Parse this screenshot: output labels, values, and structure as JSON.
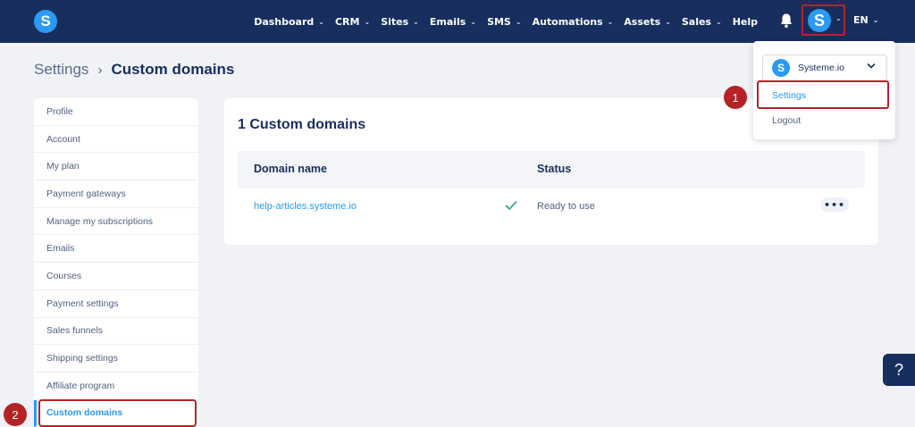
{
  "brand": {
    "logo_letter": "S"
  },
  "nav": {
    "items": [
      {
        "label": "Dashboard",
        "has_dropdown": true
      },
      {
        "label": "CRM",
        "has_dropdown": true
      },
      {
        "label": "Sites",
        "has_dropdown": true
      },
      {
        "label": "Emails",
        "has_dropdown": true
      },
      {
        "label": "SMS",
        "has_dropdown": true
      },
      {
        "label": "Automations",
        "has_dropdown": true
      },
      {
        "label": "Assets",
        "has_dropdown": true
      },
      {
        "label": "Sales",
        "has_dropdown": true
      },
      {
        "label": "Help",
        "has_dropdown": false
      }
    ],
    "bell_icon": "bell-icon",
    "avatar_letter": "S",
    "language": "EN"
  },
  "breadcrumb": {
    "parent": "Settings",
    "separator": "›",
    "current": "Custom domains"
  },
  "sidebar": {
    "items": [
      {
        "label": "Profile",
        "active": false
      },
      {
        "label": "Account",
        "active": false
      },
      {
        "label": "My plan",
        "active": false
      },
      {
        "label": "Payment gateways",
        "active": false
      },
      {
        "label": "Manage my subscriptions",
        "active": false
      },
      {
        "label": "Emails",
        "active": false
      },
      {
        "label": "Courses",
        "active": false
      },
      {
        "label": "Payment settings",
        "active": false
      },
      {
        "label": "Sales funnels",
        "active": false
      },
      {
        "label": "Shipping settings",
        "active": false
      },
      {
        "label": "Affiliate program",
        "active": false
      },
      {
        "label": "Custom domains",
        "active": true
      }
    ]
  },
  "main": {
    "title": "1 Custom domains",
    "table": {
      "headers": {
        "domain": "Domain name",
        "status": "Status"
      },
      "rows": [
        {
          "domain": "help-articles.systeme.io",
          "status": "Ready to use",
          "status_icon": "check-icon",
          "actions": "•••"
        }
      ]
    }
  },
  "dropdown": {
    "account_logo_letter": "S",
    "account_name": "Systeme.io",
    "items": {
      "settings": "Settings",
      "logout": "Logout"
    }
  },
  "annotations": {
    "step_1": "1",
    "step_2": "2"
  },
  "help_button": "?",
  "colors": {
    "nav_bg": "#172e5e",
    "accent": "#2b9af3",
    "highlight": "#b52326",
    "page_bg": "#f0f2f6",
    "success": "#1aa37a"
  }
}
